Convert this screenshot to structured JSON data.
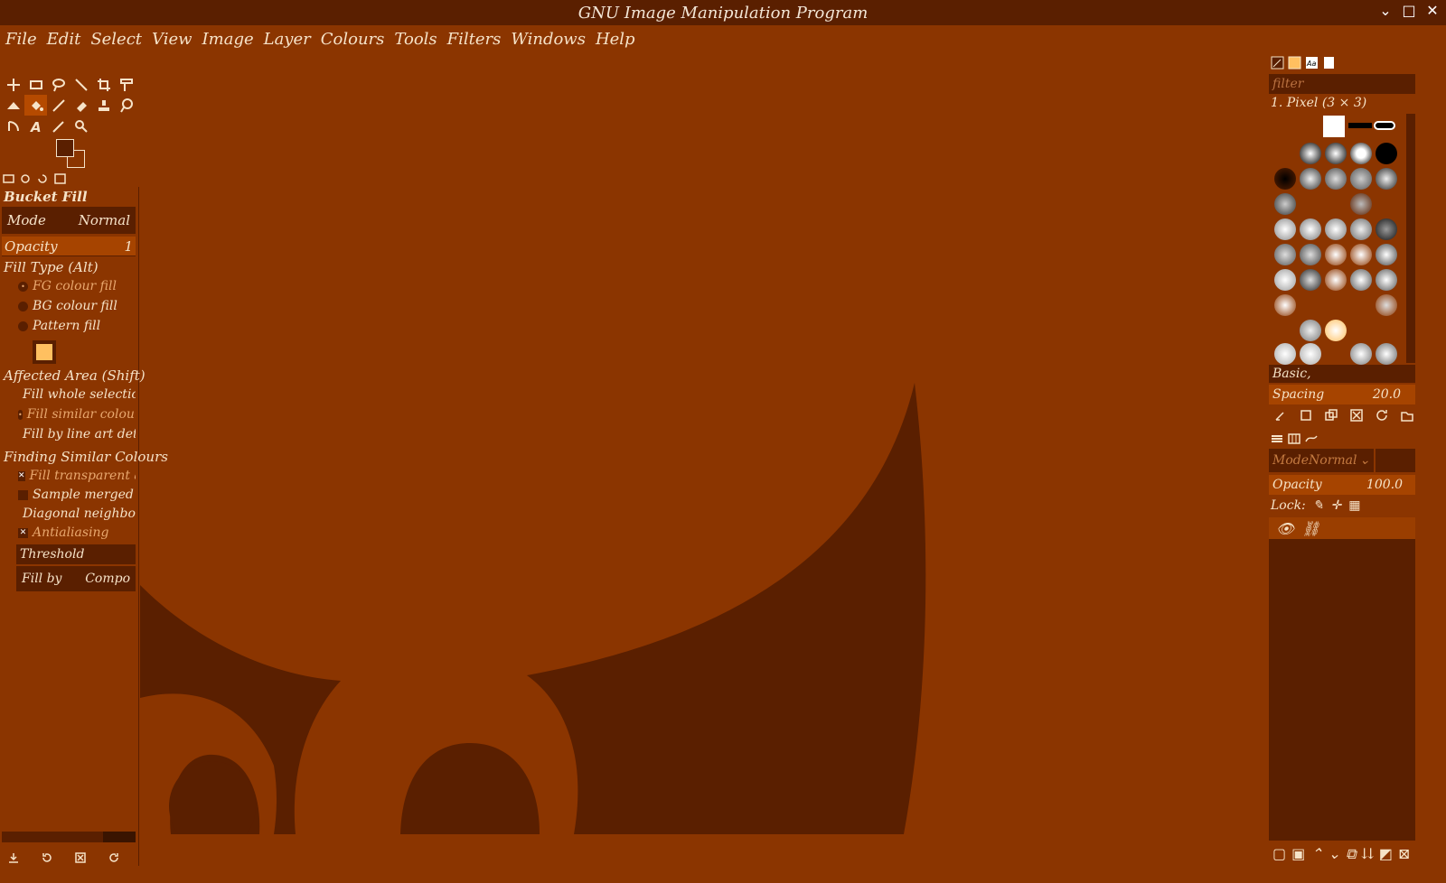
{
  "window": {
    "title": "GNU Image Manipulation Program"
  },
  "menu": [
    "File",
    "Edit",
    "Select",
    "View",
    "Image",
    "Layer",
    "Colours",
    "Tools",
    "Filters",
    "Windows",
    "Help"
  ],
  "tool_options": {
    "title": "Bucket Fill",
    "mode_label": "Mode",
    "mode_value": "Normal",
    "opacity_label": "Opacity",
    "opacity_value": "1",
    "fill_type_label": "Fill Type  (Alt)",
    "fill_type_options": [
      "FG colour fill",
      "BG colour fill",
      "Pattern fill"
    ],
    "affected_area_label": "Affected Area  (Shift)",
    "affected_area_options": [
      "Fill whole selection",
      "Fill similar colours",
      "Fill by line art detection"
    ],
    "finding_label": "Finding Similar Colours",
    "finding_options": [
      "Fill transparent areas",
      "Sample merged",
      "Diagonal neighbours",
      "Antialiasing"
    ],
    "threshold_label": "Threshold",
    "fill_by_label": "Fill by",
    "fill_by_value": "Compo"
  },
  "brushes": {
    "filter_placeholder": "filter",
    "selected_brush": "1. Pixel (3 × 3)",
    "preset": "Basic,",
    "spacing_label": "Spacing",
    "spacing_value": "20.0"
  },
  "layers": {
    "mode_label": "ModeNormal",
    "opacity_label": "Opacity",
    "opacity_value": "100.0",
    "lock_label": "Lock:"
  },
  "colors": {
    "background": "#8b3500",
    "dark": "#5a1f00",
    "text": "#f6e3c8",
    "pattern": "#ffc060"
  }
}
